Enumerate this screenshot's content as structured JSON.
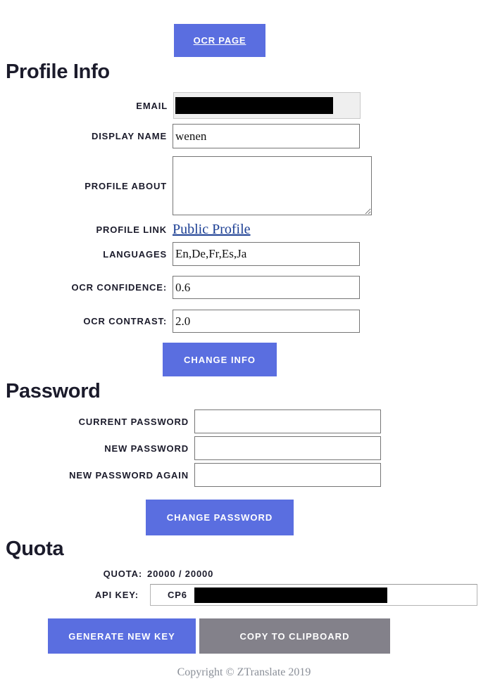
{
  "toolbar": {
    "ocr_page_label": "OCR PAGE"
  },
  "profile": {
    "heading": "Profile Info",
    "fields": [
      {
        "label": "EMAIL",
        "value": "",
        "redacted": true,
        "disabled": true,
        "type": "text"
      },
      {
        "label": "DISPLAY NAME",
        "value": "wenen",
        "redacted": false,
        "disabled": false,
        "type": "text"
      },
      {
        "label": "PROFILE ABOUT",
        "value": "",
        "redacted": false,
        "disabled": false,
        "type": "textarea"
      },
      {
        "label": "PROFILE LINK",
        "value": "Public Profile",
        "redacted": false,
        "disabled": false,
        "type": "link"
      },
      {
        "label": "LANGUAGES",
        "value": "En,De,Fr,Es,Ja",
        "redacted": false,
        "disabled": false,
        "type": "text"
      },
      {
        "label": "OCR CONFIDENCE:",
        "value": "0.6",
        "redacted": false,
        "disabled": false,
        "type": "text"
      },
      {
        "label": "OCR CONTRAST:",
        "value": "2.0",
        "redacted": false,
        "disabled": false,
        "type": "text"
      }
    ],
    "submit_label": "CHANGE INFO"
  },
  "password": {
    "heading": "Password",
    "fields": [
      {
        "label": "CURRENT PASSWORD",
        "value": ""
      },
      {
        "label": "NEW PASSWORD",
        "value": ""
      },
      {
        "label": "NEW PASSWORD AGAIN",
        "value": ""
      }
    ],
    "submit_label": "CHANGE PASSWORD"
  },
  "quota": {
    "heading": "Quota",
    "quota_label": "QUOTA:",
    "quota_value": "20000 / 20000",
    "api_key_label": "API KEY:",
    "api_key_value": "CP6",
    "api_key_redacted": true,
    "generate_label": "GENERATE NEW KEY",
    "copy_label": "COPY TO CLIPBOARD"
  },
  "footer": {
    "copyright": "Copyright © ZTranslate 2019"
  },
  "colors": {
    "primary": "#5a6ee0",
    "secondary": "#83818a",
    "heading": "#1b1b2b",
    "link": "#1c3f94",
    "footer_text": "#8a8f98",
    "disabled_bg": "#efefef"
  }
}
